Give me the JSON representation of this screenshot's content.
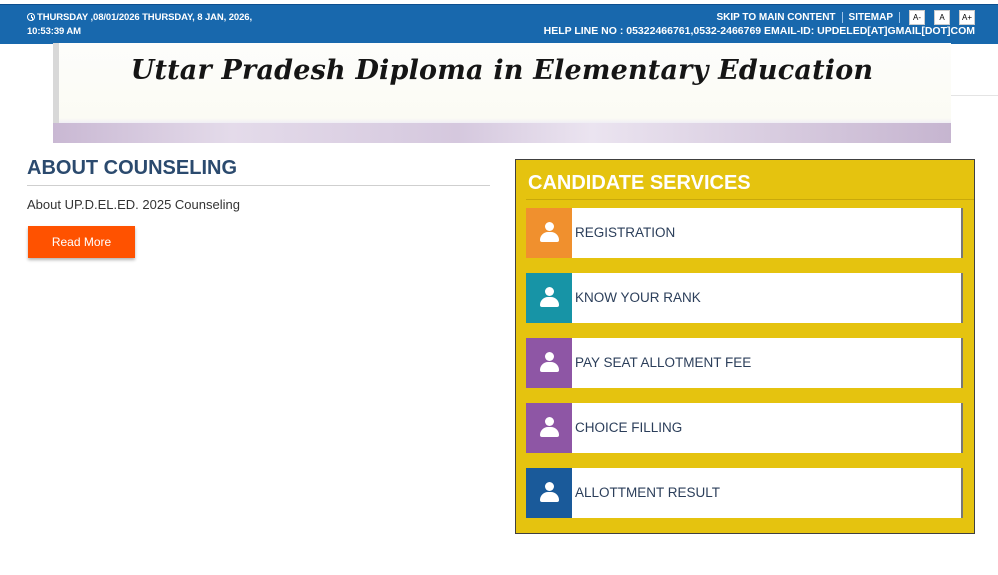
{
  "header": {
    "datetime": "THURSDAY ,08/01/2026 THURSDAY, 8 JAN, 2026, 10:53:39 AM",
    "skip_link": "SKIP TO MAIN CONTENT",
    "sitemap": "SITEMAP",
    "font_decrease": "A-",
    "font_normal": "A",
    "font_increase": "A+",
    "helpline": "HELP LINE NO : 05322466761,0532-2466769 EMAIL-ID: UPDELED[AT]GMAIL[DOT]COM"
  },
  "banner": {
    "title": "Uttar Pradesh Diploma in Elementary Education"
  },
  "about": {
    "heading": "ABOUT COUNSELING",
    "text": "About UP.D.EL.ED. 2025 Counseling",
    "button": "Read More"
  },
  "services": {
    "heading": "CANDIDATE SERVICES",
    "items": [
      {
        "label": "REGISTRATION",
        "icon": "user-icon",
        "color": "#f0902e"
      },
      {
        "label": "KNOW YOUR RANK",
        "icon": "user-icon",
        "color": "#1794a6"
      },
      {
        "label": "PAY SEAT ALLOTMENT FEE",
        "icon": "user-icon",
        "color": "#8e56a5"
      },
      {
        "label": "CHOICE FILLING",
        "icon": "user-icon",
        "color": "#8e56a5"
      },
      {
        "label": "ALLOTTMENT RESULT",
        "icon": "user-icon",
        "color": "#1a5a9a"
      }
    ]
  },
  "colors": {
    "topbar": "#1868ad",
    "panel": "#e5c30f",
    "read_more": "#ff5200",
    "heading": "#2b4a6e"
  }
}
